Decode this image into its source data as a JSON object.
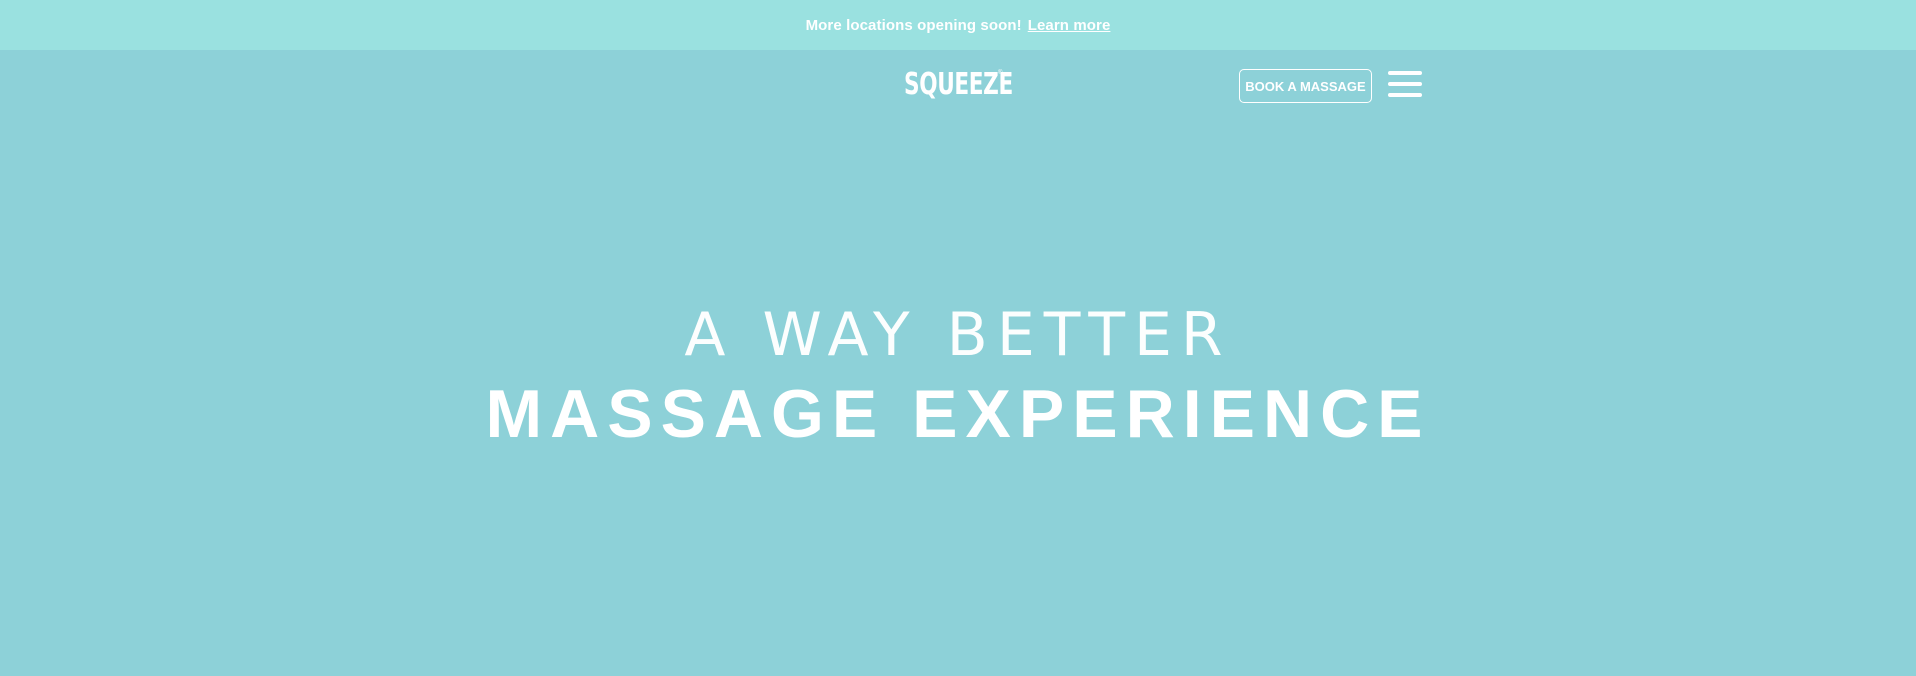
{
  "announcement": {
    "message": "More locations opening soon!",
    "link_label": "Learn more"
  },
  "header": {
    "logo_text": "SQUEEZE",
    "logo_mark": "®",
    "book_button_label": "BOOK A MASSAGE",
    "menu_icon": "hamburger-menu-icon"
  },
  "hero": {
    "line1": "A WAY BETTER",
    "line2": "MASSAGE EXPERIENCE"
  },
  "colors": {
    "background": "#8dd1d8",
    "announcement_bar": "#9ae1e0",
    "text": "#ffffff"
  }
}
